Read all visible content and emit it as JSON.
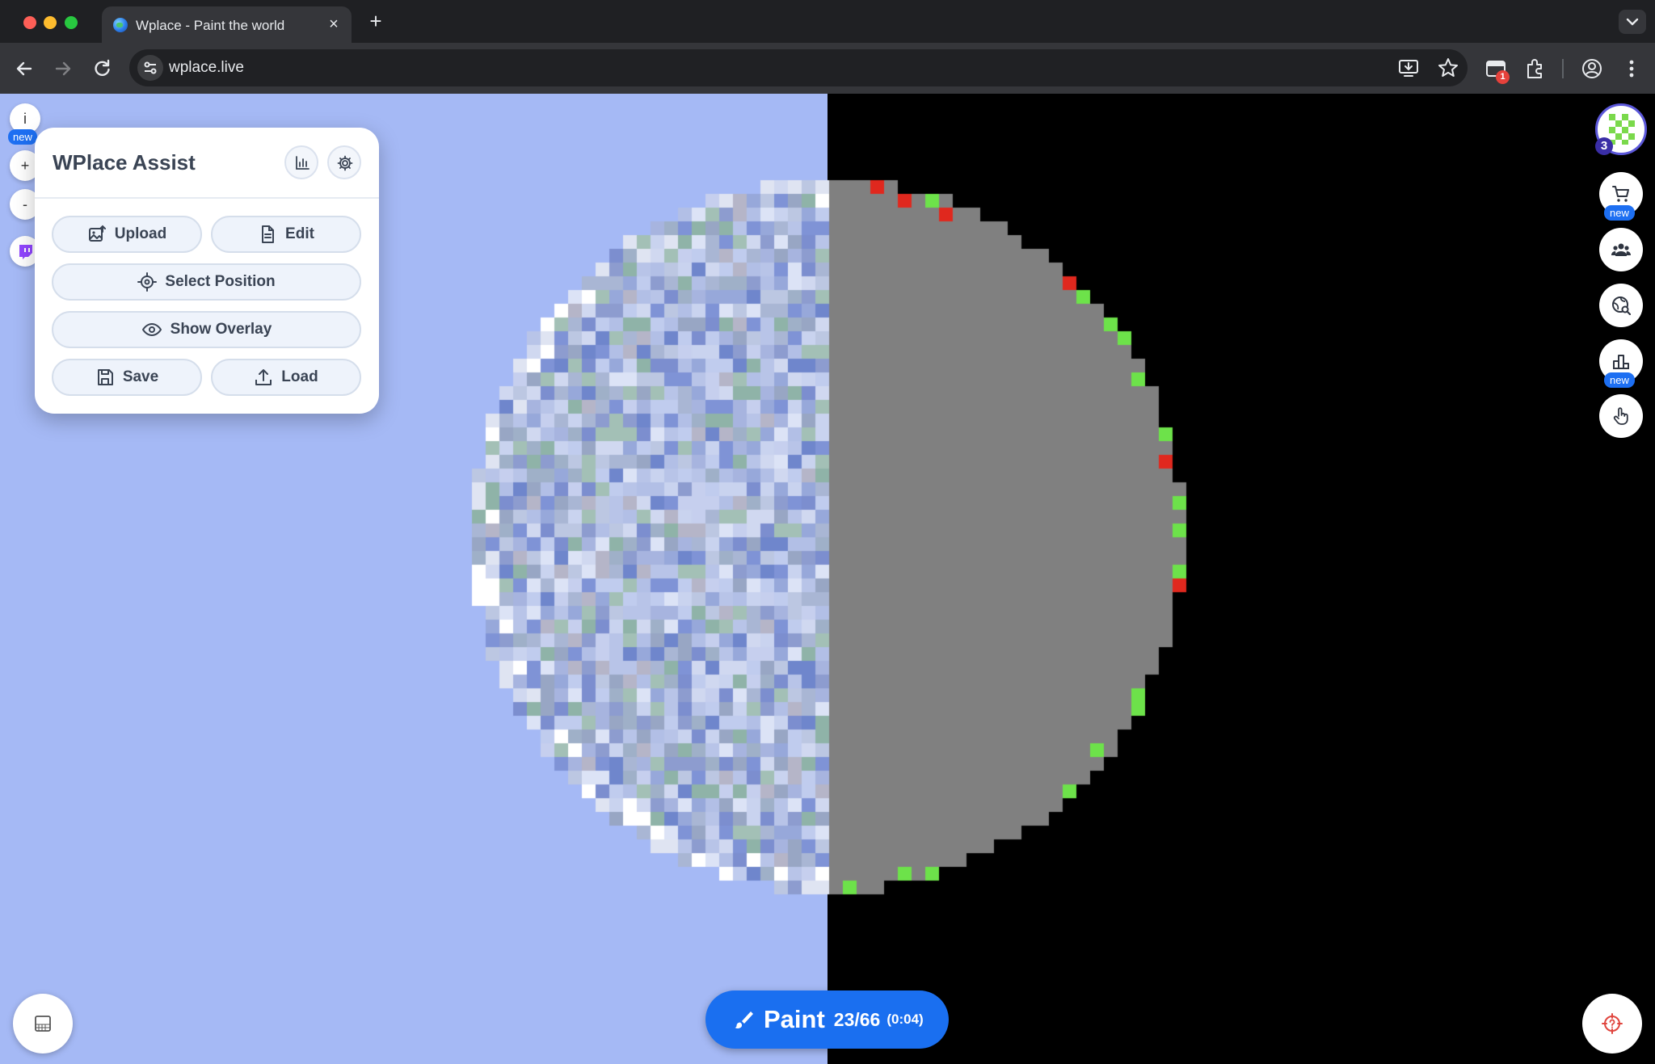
{
  "browser": {
    "tab_title": "Wplace - Paint the world",
    "url": "wplace.live",
    "extension_badge": "1"
  },
  "left_controls": {
    "info_label": "i",
    "new_badge": "new",
    "zoom_in": "+",
    "zoom_out": "-"
  },
  "assist_panel": {
    "title": "WPlace Assist",
    "buttons": {
      "upload": "Upload",
      "edit": "Edit",
      "select_position": "Select Position",
      "show_overlay": "Show Overlay",
      "save": "Save",
      "load": "Load"
    }
  },
  "right_rail": {
    "level": "3",
    "store_new": "new",
    "leaderboard_new": "new"
  },
  "paint": {
    "label": "Paint",
    "count": "23/66",
    "timer": "(0:04)"
  },
  "colors": {
    "accent": "#1a6ff0",
    "map_left": "#a5b9f5",
    "map_right": "#000000",
    "template_gray": "#808080",
    "correct_pixel": "#6de24a",
    "wrong_pixel": "#e0281e"
  }
}
